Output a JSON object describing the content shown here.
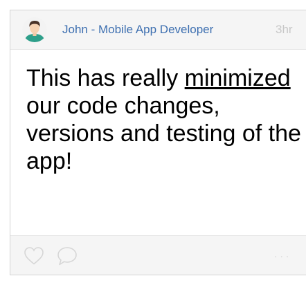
{
  "post": {
    "author": "John - Mobile App Developer",
    "time": "3hr",
    "text_part1": "This has really ",
    "text_emphasis": "minimized",
    "text_part2": " our code changes, versions and testing of the app!"
  },
  "footer": {
    "like_icon": "heart-outline-icon",
    "comment_icon": "speech-bubble-icon",
    "more_icon": "ellipsis-icon",
    "more_label": "..."
  },
  "colors": {
    "author": "#3d6fb0",
    "muted": "#c8c8c8",
    "header_bg": "#f5f5f5"
  }
}
